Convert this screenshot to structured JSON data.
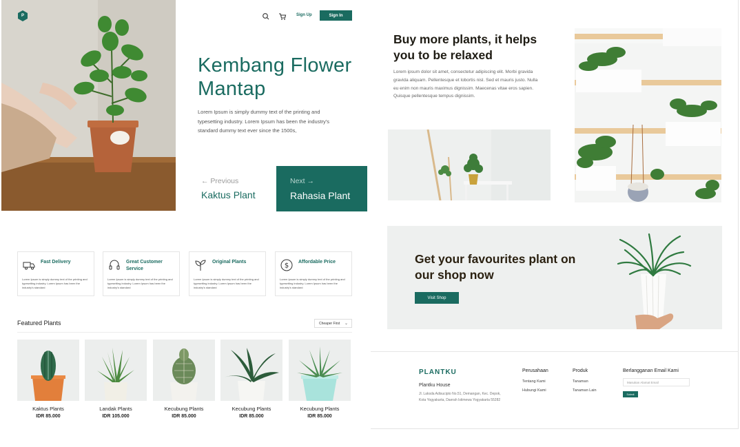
{
  "left_page": {
    "logo": "P",
    "nav": {
      "signup": "Sign Up",
      "signin": "Sign In"
    },
    "hero": {
      "title": "Kembang Flower Mantap",
      "description": "Lorem Ipsum is simply dummy text of the printing and typesetting industry. Lorem Ipsum has been the industry's standard dummy text ever since the 1500s,"
    },
    "pager": {
      "previous_label": "Previous",
      "previous_title": "Kaktus Plant",
      "next_label": "Next",
      "next_title": "Rahasia Plant"
    },
    "features": [
      {
        "title": "Fast Delivery",
        "icon": "truck-icon",
        "text": "Lorem Ipsum is simply dummy text of the printing and typesetting industry. Lorem Ipsum has been the industry's standard"
      },
      {
        "title": "Great Customer Service",
        "icon": "headset-icon",
        "text": "Lorem Ipsum is simply dummy text of the printing and typesetting industry. Lorem Ipsum has been the industry's standard"
      },
      {
        "title": "Original Plants",
        "icon": "sprout-icon",
        "text": "Lorem Ipsum is simply dummy text of the printing and typesetting industry. Lorem Ipsum has been the industry's standard"
      },
      {
        "title": "Affordable Price",
        "icon": "dollar-icon",
        "text": "Lorem Ipsum is simply dummy text of the printing and typesetting industry. Lorem Ipsum has been the industry's standard"
      }
    ],
    "featured": {
      "title": "Featured Plants",
      "sort_value": "Cheaper First",
      "products": [
        {
          "name": "Kaktus Plants",
          "price": "IDR 85.000"
        },
        {
          "name": "Landak Plants",
          "price": "IDR 105.000"
        },
        {
          "name": "Kecubung Plants",
          "price": "IDR 85.000"
        },
        {
          "name": "Kecubung Plants",
          "price": "IDR 85.000"
        },
        {
          "name": "Kecubung Plants",
          "price": "IDR 85.000"
        }
      ]
    }
  },
  "right_page": {
    "about": {
      "title": "Buy more plants, it helps you to be relaxed",
      "description": "Lorem ipsum dolor sit amet, consectetur adipiscing elit. Morbi gravida gravida aliquam. Pellentesque et lobortis nisl. Sed et mauris justo. Nulla eu enim non mauris maximus dignissim. Maecenas vitae eros sapien. Quisque pellentesque tempus dignissim."
    },
    "promo": {
      "title": "Get your favourites plant on our shop now",
      "button": "Visit Shop"
    },
    "footer": {
      "brand": "PLANTKU",
      "house": "Plantku House",
      "address": "Jl. Laksda Adisucipto No.51, Demangan, Kec. Depok, Kota Yogyakarta, Daerah Istimewa Yogyakarta 55282",
      "col1_head": "Perusahaan",
      "col1_links": [
        "Tentang Kami",
        "Hubungi Kami"
      ],
      "col2_head": "Produk",
      "col2_links": [
        "Tanaman",
        "Tanaman Lain"
      ],
      "newsletter_head": "Berlangganan Email Kami",
      "newsletter_placeholder": "Masukan Alamat Email",
      "newsletter_button": "Submit"
    }
  },
  "colors": {
    "accent": "#1a6b60",
    "dark_heading": "#1e1b13",
    "promo_bg": "#eef0ef"
  }
}
